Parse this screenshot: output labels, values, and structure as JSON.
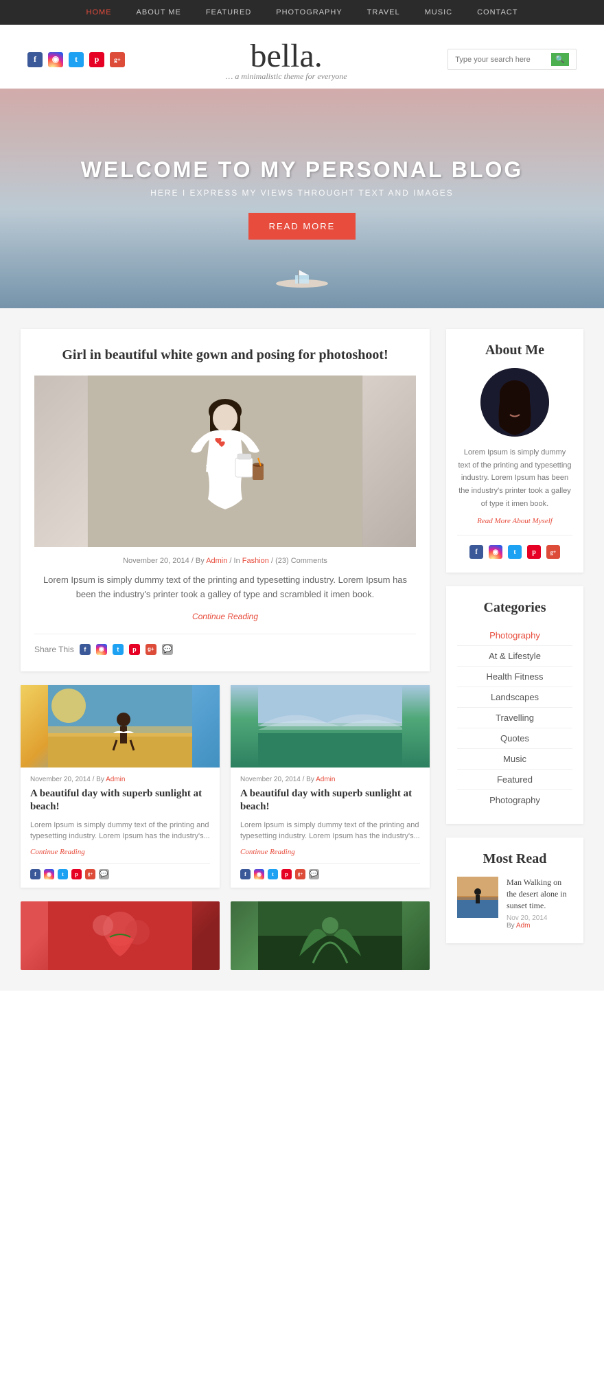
{
  "nav": {
    "items": [
      {
        "label": "HOME",
        "active": true
      },
      {
        "label": "ABOUT ME",
        "active": false
      },
      {
        "label": "FEATURED",
        "active": false
      },
      {
        "label": "PHOTOGRAPHY",
        "active": false
      },
      {
        "label": "TRAVEL",
        "active": false
      },
      {
        "label": "MUSIC",
        "active": false
      },
      {
        "label": "CONTACT",
        "active": false
      }
    ]
  },
  "header": {
    "logo": "bella.",
    "tagline": "… a minimalistic theme for everyone",
    "search_placeholder": "Type your search here"
  },
  "hero": {
    "title": "WELCOME TO MY PERSONAL BLOG",
    "subtitle": "HERE I EXPRESS MY VIEWS THROUGHT TEXT AND IMAGES",
    "button": "READ MORE"
  },
  "main_article": {
    "title": "Girl in beautiful white gown and posing for photoshoot!",
    "date": "November 20, 2014",
    "author": "Admin",
    "category": "Fashion",
    "comments": "(23) Comments",
    "excerpt": "Lorem Ipsum is simply dummy text of the printing and typesetting industry. Lorem Ipsum has been the industry's printer took a galley of type and scrambled it imen book.",
    "continue": "Continue Reading"
  },
  "small_articles": [
    {
      "date": "November 20, 2014",
      "author": "Admin",
      "title": "A beautiful day with superb sunlight at beach!",
      "excerpt": "Lorem Ipsum is simply dummy text of the printing and typesetting industry. Lorem Ipsum has the industry's...",
      "continue": "Continue Reading"
    },
    {
      "date": "November 20, 2014",
      "author": "Admin",
      "title": "A beautiful day with superb sunlight at beach!",
      "excerpt": "Lorem Ipsum is simply dummy text of the printing and typesetting industry. Lorem Ipsum has the industry's...",
      "continue": "Continue Reading"
    }
  ],
  "sidebar": {
    "about": {
      "title": "About Me",
      "text": "Lorem Ipsum is simply dummy text of the printing and typesetting industry. Lorem Ipsum has been the industry's printer took a galley of type it imen book.",
      "link": "Read More About Myself"
    },
    "categories": {
      "title": "Categories",
      "items": [
        {
          "label": "Photography",
          "active": true
        },
        {
          "label": "At & Lifestyle",
          "active": false
        },
        {
          "label": "Health Fitness",
          "active": false
        },
        {
          "label": "Landscapes",
          "active": false
        },
        {
          "label": "Travelling",
          "active": false
        },
        {
          "label": "Quotes",
          "active": false
        },
        {
          "label": "Music",
          "active": false
        },
        {
          "label": "Featured",
          "active": false
        },
        {
          "label": "Photography",
          "active": false
        }
      ]
    },
    "most_read": {
      "title": "Most Read",
      "items": [
        {
          "title": "Man Walking on the desert alone in sunset time.",
          "date": "Nov 20, 2014",
          "author": "Adm"
        }
      ]
    }
  },
  "social": {
    "facebook": "f",
    "instagram": "◉",
    "twitter": "t",
    "pinterest": "p",
    "googleplus": "g+"
  }
}
